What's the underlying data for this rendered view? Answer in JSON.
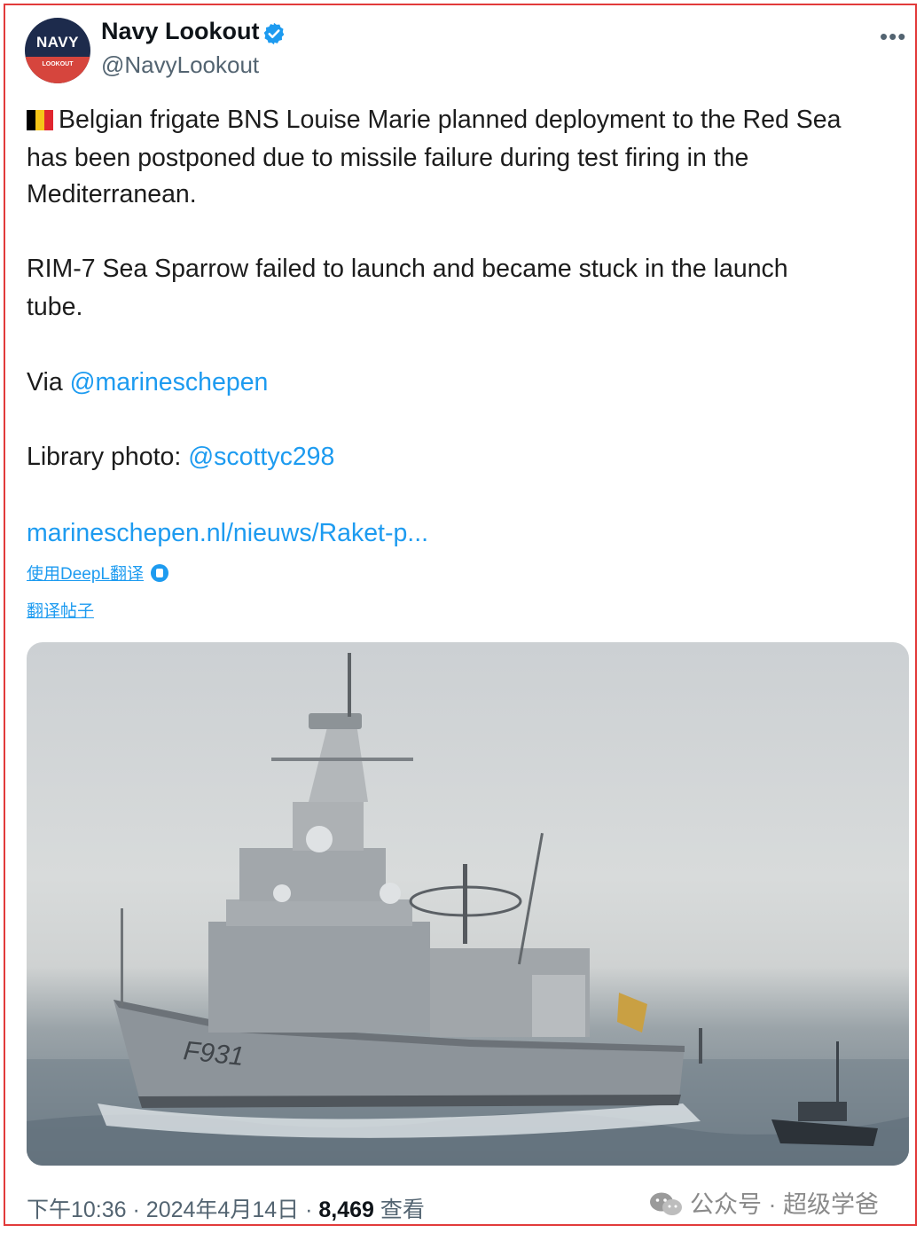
{
  "tweet": {
    "author_name": "Navy Lookout",
    "handle": "@NavyLookout",
    "avatar_text_top": "NAVY",
    "avatar_text_bottom": "LOOKOUT",
    "body_line1": "Belgian frigate BNS Louise Marie planned deployment to the Red Sea",
    "body_line2": "has been postponed due to missile failure during test firing in the",
    "body_line3": "Mediterranean.",
    "body_line4": "RIM-7 Sea Sparrow failed to launch and became stuck in the launch",
    "body_line5": "tube.",
    "via_label": "Via",
    "via_mention": "@marineschepen",
    "library_label": "Library photo:",
    "library_mention": "@scottyc298",
    "url": "marineschepen.nl/nieuws/Raket-p...",
    "deepl_label": "使用DeepL翻译",
    "translate_label": "翻译帖子",
    "photo_hull_number": "F931",
    "time": "下午10:36",
    "date": "2024年4月14日",
    "views_count": "8,469",
    "views_label": "查看"
  },
  "watermark": {
    "text": "公众号 · 超级学爸"
  },
  "colors": {
    "link": "#1d9bf0",
    "frame_border": "#e23b3b",
    "flag": [
      "#000000",
      "#f5c518",
      "#e0262f"
    ]
  }
}
